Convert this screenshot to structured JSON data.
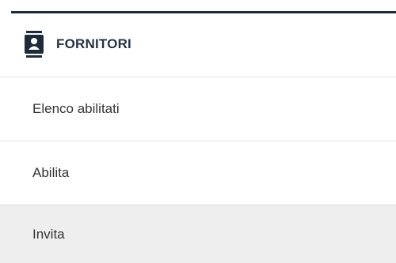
{
  "header": {
    "title": "FORNITORI",
    "icon": "contacts-book-icon",
    "accent_color": "#1d2b3a"
  },
  "menu": {
    "items": [
      {
        "label": "Elenco abilitati",
        "active": false
      },
      {
        "label": "Abilita",
        "active": false
      },
      {
        "label": "Invita",
        "active": true
      }
    ]
  },
  "colors": {
    "active_background": "#eeeeee",
    "title_color": "#243246",
    "text_color": "#333333"
  }
}
